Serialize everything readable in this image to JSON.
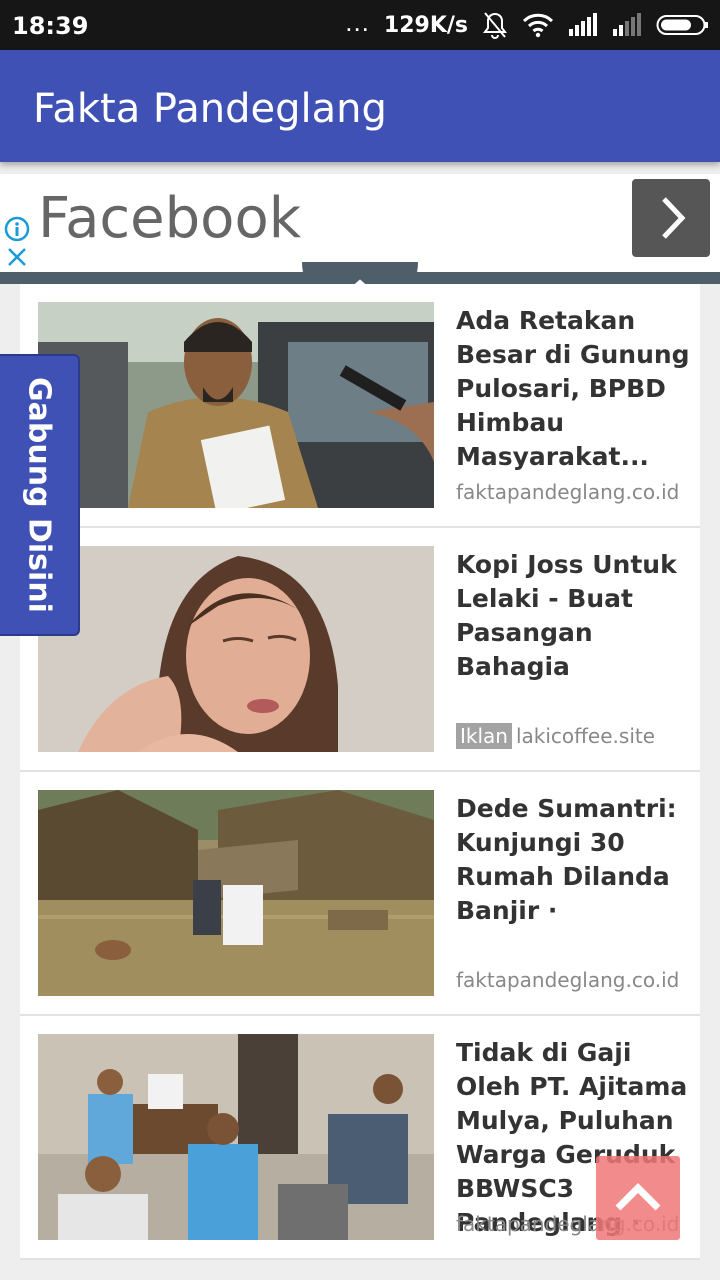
{
  "status_bar": {
    "time": "18:39",
    "dots": "...",
    "net_speed": "129K/s",
    "icons": [
      "muted-bell-icon",
      "wifi-icon",
      "signal-icon",
      "signal-weak-icon",
      "battery-icon"
    ]
  },
  "app_bar": {
    "title": "Fakta Pandeglang"
  },
  "ad_banner": {
    "text": "Facebook",
    "icons": [
      "ad-info-icon",
      "ad-close-icon",
      "chevron-right-icon"
    ]
  },
  "side_tab": {
    "label": "Gabung Disini"
  },
  "articles": [
    {
      "headline": "Ada Retakan Besar di Gunung Pulosari, BPBD Himbau Masyarakat...",
      "source": "faktapandeglang.co.id",
      "image": "official-with-documents-photo"
    },
    {
      "headline": "Kopi Joss Untuk Lelaki - Buat Pasangan Bahagia",
      "ad_badge": "Iklan",
      "source": "lakicoffee.site",
      "image": "woman-portrait-photo"
    },
    {
      "headline": "Dede Sumantri: Kunjungi 30 Rumah Dilanda Banjir ·",
      "source": "faktapandeglang.co.id",
      "image": "flooded-village-photo"
    },
    {
      "headline": "Tidak di Gaji Oleh PT. Ajitama Mulya, Puluhan Warga Geruduk BBWSC3 Pandeglang ·",
      "source": "faktapandeglang.co.id",
      "image": "meeting-room-photo"
    }
  ],
  "colors": {
    "primary": "#3f51b5",
    "status_bar": "#161616",
    "scroll_top": "#f07878"
  }
}
